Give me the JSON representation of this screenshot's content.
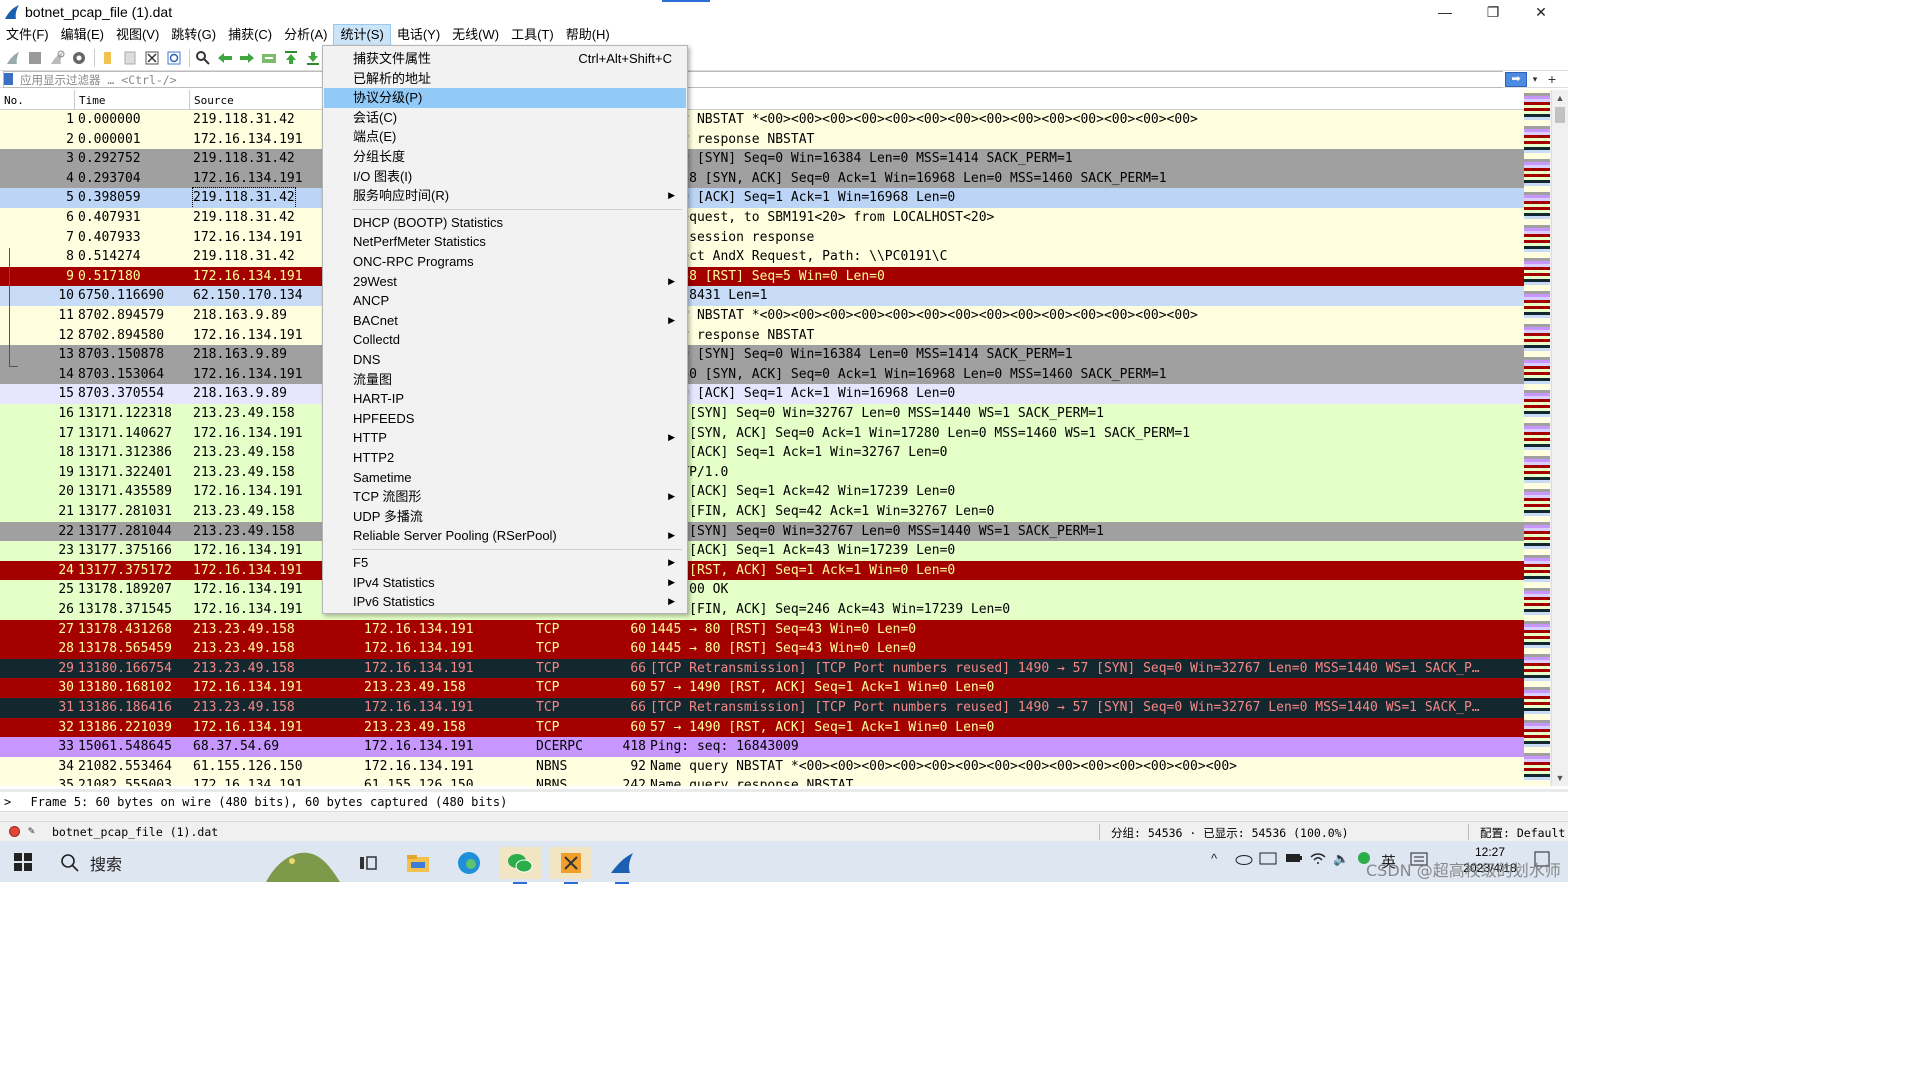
{
  "window": {
    "title": "botnet_pcap_file (1).dat",
    "minimize": "—",
    "maximize": "❐",
    "close": "✕"
  },
  "menubar": [
    {
      "label": "文件(F)"
    },
    {
      "label": "编辑(E)"
    },
    {
      "label": "视图(V)"
    },
    {
      "label": "跳转(G)"
    },
    {
      "label": "捕获(C)"
    },
    {
      "label": "分析(A)"
    },
    {
      "label": "统计(S)",
      "active": true
    },
    {
      "label": "电话(Y)"
    },
    {
      "label": "无线(W)"
    },
    {
      "label": "工具(T)"
    },
    {
      "label": "帮助(H)"
    }
  ],
  "filter": {
    "placeholder": "应用显示过滤器 … <Ctrl-/>",
    "apply": "➡",
    "dropdown": "▾",
    "add": "+"
  },
  "columns": {
    "no": "No.",
    "time": "Time",
    "source": "Source"
  },
  "colors": {
    "lightYellow": "#ffffe0",
    "paleGreen": "#e4ffc7",
    "gray": "#a0a0a0",
    "lightBlue": "#c8dcf7",
    "selectedBlue": "#bcd4f5",
    "darkRed": "#a40000",
    "lavender": "#e7e6ff",
    "darkNavy": "#12272e",
    "purple": "#c797ff",
    "lightPurple": "#dad0ff"
  },
  "packets": [
    {
      "no": "1",
      "time": "0.000000",
      "src": "219.118.31.42",
      "dst": "",
      "proto": "",
      "len": "",
      "info": "query NBSTAT *<00><00><00><00><00><00><00><00><00><00><00><00><00><00>",
      "bg": "lightYellow",
      "fg": "#000"
    },
    {
      "no": "2",
      "time": "0.000001",
      "src": "172.16.134.191",
      "dst": "",
      "proto": "",
      "len": "",
      "info": "query response NBSTAT",
      "bg": "lightYellow",
      "fg": "#000"
    },
    {
      "no": "3",
      "time": "0.292752",
      "src": "219.118.31.42",
      "dst": "",
      "proto": "",
      "len": "",
      "info": "→ 139 [SYN] Seq=0 Win=16384 Len=0 MSS=1414 SACK_PERM=1",
      "bg": "gray",
      "fg": "#000"
    },
    {
      "no": "4",
      "time": "0.293704",
      "src": "172.16.134.191",
      "dst": "",
      "proto": "",
      "len": "",
      "info": "→ 2388 [SYN, ACK] Seq=0 Ack=1 Win=16968 Len=0 MSS=1460 SACK_PERM=1",
      "bg": "gray",
      "fg": "#000"
    },
    {
      "no": "5",
      "time": "0.398059",
      "src": "219.118.31.42",
      "dst": "",
      "proto": "",
      "len": "",
      "info": "→ 139 [ACK] Seq=1 Ack=1 Win=16968 Len=0",
      "bg": "selectedBlue",
      "fg": "#000",
      "selected": true
    },
    {
      "no": "6",
      "time": "0.407931",
      "src": "219.118.31.42",
      "dst": "",
      "proto": "",
      "len": "",
      "info": "on request, to SBM191<20> from LOCALHOST<20>",
      "bg": "lightYellow",
      "fg": "#000"
    },
    {
      "no": "7",
      "time": "0.407933",
      "src": "172.16.134.191",
      "dst": "",
      "proto": "",
      "len": "",
      "info": "tive session response",
      "bg": "lightYellow",
      "fg": "#000"
    },
    {
      "no": "8",
      "time": "0.514274",
      "src": "219.118.31.42",
      "dst": "",
      "proto": "",
      "len": "",
      "info": "Connect AndX Request, Path: \\\\PC0191\\C",
      "bg": "lightYellow",
      "fg": "#000"
    },
    {
      "no": "9",
      "time": "0.517180",
      "src": "172.16.134.191",
      "dst": "",
      "proto": "",
      "len": "",
      "info": "→ 2388 [RST] Seq=5 Win=0 Len=0",
      "bg": "darkRed",
      "fg": "#ffff9b"
    },
    {
      "no": "10",
      "time": "6750.116690",
      "src": "62.150.170.134",
      "dst": "",
      "proto": "",
      "len": "",
      "info": "2 → 28431 Len=1",
      "bg": "lightBlue",
      "fg": "#000"
    },
    {
      "no": "11",
      "time": "8702.894579",
      "src": "218.163.9.89",
      "dst": "",
      "proto": "",
      "len": "",
      "info": "query NBSTAT *<00><00><00><00><00><00><00><00><00><00><00><00><00><00>",
      "bg": "lightYellow",
      "fg": "#000"
    },
    {
      "no": "12",
      "time": "8702.894580",
      "src": "172.16.134.191",
      "dst": "",
      "proto": "",
      "len": "",
      "info": "query response NBSTAT",
      "bg": "lightYellow",
      "fg": "#000"
    },
    {
      "no": "13",
      "time": "8703.150878",
      "src": "218.163.9.89",
      "dst": "",
      "proto": "",
      "len": "",
      "info": "→ 139 [SYN] Seq=0 Win=16384 Len=0 MSS=1414 SACK_PERM=1",
      "bg": "gray",
      "fg": "#000"
    },
    {
      "no": "14",
      "time": "8703.153064",
      "src": "172.16.134.191",
      "dst": "",
      "proto": "",
      "len": "",
      "info": "→ 4760 [SYN, ACK] Seq=0 Ack=1 Win=16968 Len=0 MSS=1460 SACK_PERM=1",
      "bg": "gray",
      "fg": "#000"
    },
    {
      "no": "15",
      "time": "8703.370554",
      "src": "218.163.9.89",
      "dst": "",
      "proto": "",
      "len": "",
      "info": "→ 139 [ACK] Seq=1 Ack=1 Win=16968 Len=0",
      "bg": "lavender",
      "fg": "#000"
    },
    {
      "no": "16",
      "time": "13171.122318",
      "src": "213.23.49.158",
      "dst": "",
      "proto": "",
      "len": "",
      "info": "→ 80 [SYN] Seq=0 Win=32767 Len=0 MSS=1440 WS=1 SACK_PERM=1",
      "bg": "paleGreen",
      "fg": "#000"
    },
    {
      "no": "17",
      "time": "13171.140627",
      "src": "172.16.134.191",
      "dst": "",
      "proto": "",
      "len": "",
      "info": "1445 [SYN, ACK] Seq=0 Ack=1 Win=17280 Len=0 MSS=1460 WS=1 SACK_PERM=1",
      "bg": "paleGreen",
      "fg": "#000"
    },
    {
      "no": "18",
      "time": "13171.312386",
      "src": "213.23.49.158",
      "dst": "",
      "proto": "",
      "len": "",
      "info": "→ 80 [ACK] Seq=1 Ack=1 Win=32767 Len=0",
      "bg": "paleGreen",
      "fg": "#000"
    },
    {
      "no": "19",
      "time": "13171.322401",
      "src": "213.23.49.158",
      "dst": "",
      "proto": "",
      "len": "",
      "info": "/ HTTP/1.0",
      "bg": "paleGreen",
      "fg": "#000"
    },
    {
      "no": "20",
      "time": "13171.435589",
      "src": "172.16.134.191",
      "dst": "",
      "proto": "",
      "len": "",
      "info": "1445 [ACK] Seq=1 Ack=42 Win=17239 Len=0",
      "bg": "paleGreen",
      "fg": "#000"
    },
    {
      "no": "21",
      "time": "13177.281031",
      "src": "213.23.49.158",
      "dst": "",
      "proto": "",
      "len": "",
      "info": "→ 80 [FIN, ACK] Seq=42 Ack=1 Win=32767 Len=0",
      "bg": "paleGreen",
      "fg": "#000"
    },
    {
      "no": "22",
      "time": "13177.281044",
      "src": "213.23.49.158",
      "dst": "",
      "proto": "",
      "len": "",
      "info": "→ 57 [SYN] Seq=0 Win=32767 Len=0 MSS=1440 WS=1 SACK_PERM=1",
      "bg": "gray",
      "fg": "#000"
    },
    {
      "no": "23",
      "time": "13177.375166",
      "src": "172.16.134.191",
      "dst": "",
      "proto": "",
      "len": "",
      "info": "1445 [ACK] Seq=1 Ack=43 Win=17239 Len=0",
      "bg": "paleGreen",
      "fg": "#000"
    },
    {
      "no": "24",
      "time": "13177.375172",
      "src": "172.16.134.191",
      "dst": "",
      "proto": "",
      "len": "",
      "info": "1490 [RST, ACK] Seq=1 Ack=1 Win=0 Len=0",
      "bg": "darkRed",
      "fg": "#ffff9b"
    },
    {
      "no": "25",
      "time": "13178.189207",
      "src": "172.16.134.191",
      "dst": "",
      "proto": "",
      "len": "",
      "info": "1.1 200 OK",
      "bg": "paleGreen",
      "fg": "#000"
    },
    {
      "no": "26",
      "time": "13178.371545",
      "src": "172.16.134.191",
      "dst": "",
      "proto": "",
      "len": "",
      "info": "1445 [FIN, ACK] Seq=246 Ack=43 Win=17239 Len=0",
      "bg": "paleGreen",
      "fg": "#000"
    },
    {
      "no": "27",
      "time": "13178.431268",
      "src": "213.23.49.158",
      "dst": "172.16.134.191",
      "proto": "TCP",
      "len": "60",
      "info": "1445 → 80 [RST] Seq=43 Win=0 Len=0",
      "bg": "darkRed",
      "fg": "#ffff9b"
    },
    {
      "no": "28",
      "time": "13178.565459",
      "src": "213.23.49.158",
      "dst": "172.16.134.191",
      "proto": "TCP",
      "len": "60",
      "info": "1445 → 80 [RST] Seq=43 Win=0 Len=0",
      "bg": "darkRed",
      "fg": "#ffff9b"
    },
    {
      "no": "29",
      "time": "13180.166754",
      "src": "213.23.49.158",
      "dst": "172.16.134.191",
      "proto": "TCP",
      "len": "66",
      "info": "[TCP Retransmission] [TCP Port numbers reused] 1490 → 57 [SYN] Seq=0 Win=32767 Len=0 MSS=1440 WS=1 SACK_P…",
      "bg": "darkNavy",
      "fg": "#f78787"
    },
    {
      "no": "30",
      "time": "13180.168102",
      "src": "172.16.134.191",
      "dst": "213.23.49.158",
      "proto": "TCP",
      "len": "60",
      "info": "57 → 1490 [RST, ACK] Seq=1 Ack=1 Win=0 Len=0",
      "bg": "darkRed",
      "fg": "#ffff9b"
    },
    {
      "no": "31",
      "time": "13186.186416",
      "src": "213.23.49.158",
      "dst": "172.16.134.191",
      "proto": "TCP",
      "len": "66",
      "info": "[TCP Retransmission] [TCP Port numbers reused] 1490 → 57 [SYN] Seq=0 Win=32767 Len=0 MSS=1440 WS=1 SACK_P…",
      "bg": "darkNavy",
      "fg": "#f78787"
    },
    {
      "no": "32",
      "time": "13186.221039",
      "src": "172.16.134.191",
      "dst": "213.23.49.158",
      "proto": "TCP",
      "len": "60",
      "info": "57 → 1490 [RST, ACK] Seq=1 Ack=1 Win=0 Len=0",
      "bg": "darkRed",
      "fg": "#ffff9b"
    },
    {
      "no": "33",
      "time": "15061.548645",
      "src": "68.37.54.69",
      "dst": "172.16.134.191",
      "proto": "DCERPC",
      "len": "418",
      "info": "Ping: seq: 16843009",
      "bg": "purple",
      "fg": "#000"
    },
    {
      "no": "34",
      "time": "21082.553464",
      "src": "61.155.126.150",
      "dst": "172.16.134.191",
      "proto": "NBNS",
      "len": "92",
      "info": "Name query NBSTAT *<00><00><00><00><00><00><00><00><00><00><00><00><00><00>",
      "bg": "lightYellow",
      "fg": "#000"
    },
    {
      "no": "35",
      "time": "21082.555003",
      "src": "172.16.134.191",
      "dst": "61.155.126.150",
      "proto": "NBNS",
      "len": "242",
      "info": "Name query response NBSTAT",
      "bg": "lightYellow",
      "fg": "#000"
    }
  ],
  "statsMenu": [
    {
      "label": "捕获文件属性",
      "shortcut": "Ctrl+Alt+Shift+C"
    },
    {
      "label": "已解析的地址"
    },
    {
      "label": "协议分级(P)",
      "highlighted": true
    },
    {
      "label": "会话(C)"
    },
    {
      "label": "端点(E)"
    },
    {
      "label": "分组长度"
    },
    {
      "label": "I/O 图表(I)"
    },
    {
      "label": "服务响应时间(R)",
      "submenu": true
    },
    {
      "separator": true
    },
    {
      "label": "DHCP (BOOTP) Statistics"
    },
    {
      "label": "NetPerfMeter Statistics"
    },
    {
      "label": "ONC-RPC Programs"
    },
    {
      "label": "29West",
      "submenu": true
    },
    {
      "label": "ANCP"
    },
    {
      "label": "BACnet",
      "submenu": true
    },
    {
      "label": "Collectd"
    },
    {
      "label": "DNS"
    },
    {
      "label": "流量图"
    },
    {
      "label": "HART-IP"
    },
    {
      "label": "HPFEEDS"
    },
    {
      "label": "HTTP",
      "submenu": true
    },
    {
      "label": "HTTP2"
    },
    {
      "label": "Sametime"
    },
    {
      "label": "TCP 流图形",
      "submenu": true
    },
    {
      "label": "UDP 多播流"
    },
    {
      "label": "Reliable Server Pooling (RSerPool)",
      "submenu": true
    },
    {
      "separator": true
    },
    {
      "label": "F5",
      "submenu": true
    },
    {
      "label": "IPv4 Statistics",
      "submenu": true
    },
    {
      "label": "IPv6 Statistics",
      "submenu": true
    }
  ],
  "detail": {
    "line": "Frame 5: 60 bytes on wire (480 bits), 60 bytes captured (480 bits)",
    "expander": ">"
  },
  "status": {
    "file": "botnet_pcap_file (1).dat",
    "packets": "分组: 54536 · 已显示: 54536 (100.0%)",
    "profile": "配置: Default"
  },
  "taskbar": {
    "search": "搜索",
    "ime": "英",
    "time": "12:27",
    "date": "2023/4/18",
    "watermark": "CSDN @超高校级的划水师"
  }
}
